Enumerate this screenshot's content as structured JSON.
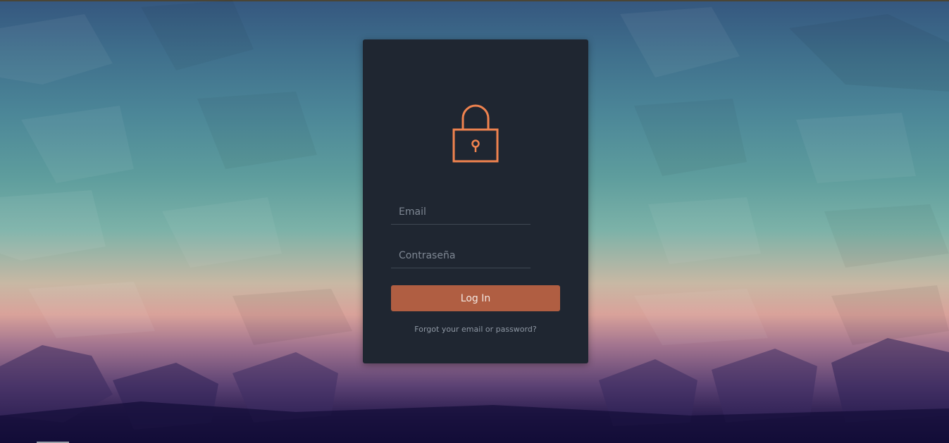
{
  "login": {
    "email_placeholder": "Email",
    "password_placeholder": "Contraseña",
    "submit_label": "Log In",
    "forgot_link": "Forgot your email or password?"
  },
  "icons": {
    "lock": "lock-icon"
  },
  "colors": {
    "card_background": "#1f2631",
    "accent": "#f0834f",
    "button": "#b05e42"
  }
}
